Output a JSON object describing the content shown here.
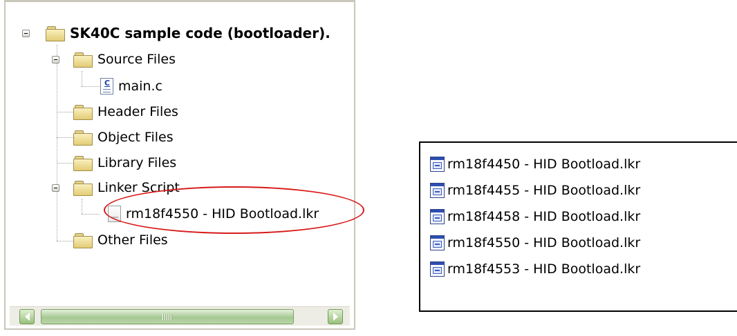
{
  "project_tree": {
    "root_label": "SK40C sample code (bootloader).",
    "folders": [
      {
        "label": "Source Files",
        "expanded": true,
        "files": [
          "main.c"
        ]
      },
      {
        "label": "Header Files",
        "expanded": false,
        "files": []
      },
      {
        "label": "Object Files",
        "expanded": false,
        "files": []
      },
      {
        "label": "Library Files",
        "expanded": false,
        "files": []
      },
      {
        "label": "Linker Script",
        "expanded": true,
        "files": [
          "rm18f4550 - HID Bootload.lkr"
        ]
      },
      {
        "label": "Other Files",
        "expanded": false,
        "files": []
      }
    ],
    "highlight_color": "#d81818"
  },
  "file_list": {
    "items": [
      "rm18f4450 - HID Bootload.lkr",
      "rm18f4455 - HID Bootload.lkr",
      "rm18f4458 - HID Bootload.lkr",
      "rm18f4550 - HID Bootload.lkr",
      "rm18f4553 - HID Bootload.lkr"
    ]
  },
  "icons": {
    "folder": "folder-icon",
    "c_source": "c-source-file-icon",
    "linker_script": "linker-script-file-icon",
    "collapse": "collapse-minus-icon"
  }
}
